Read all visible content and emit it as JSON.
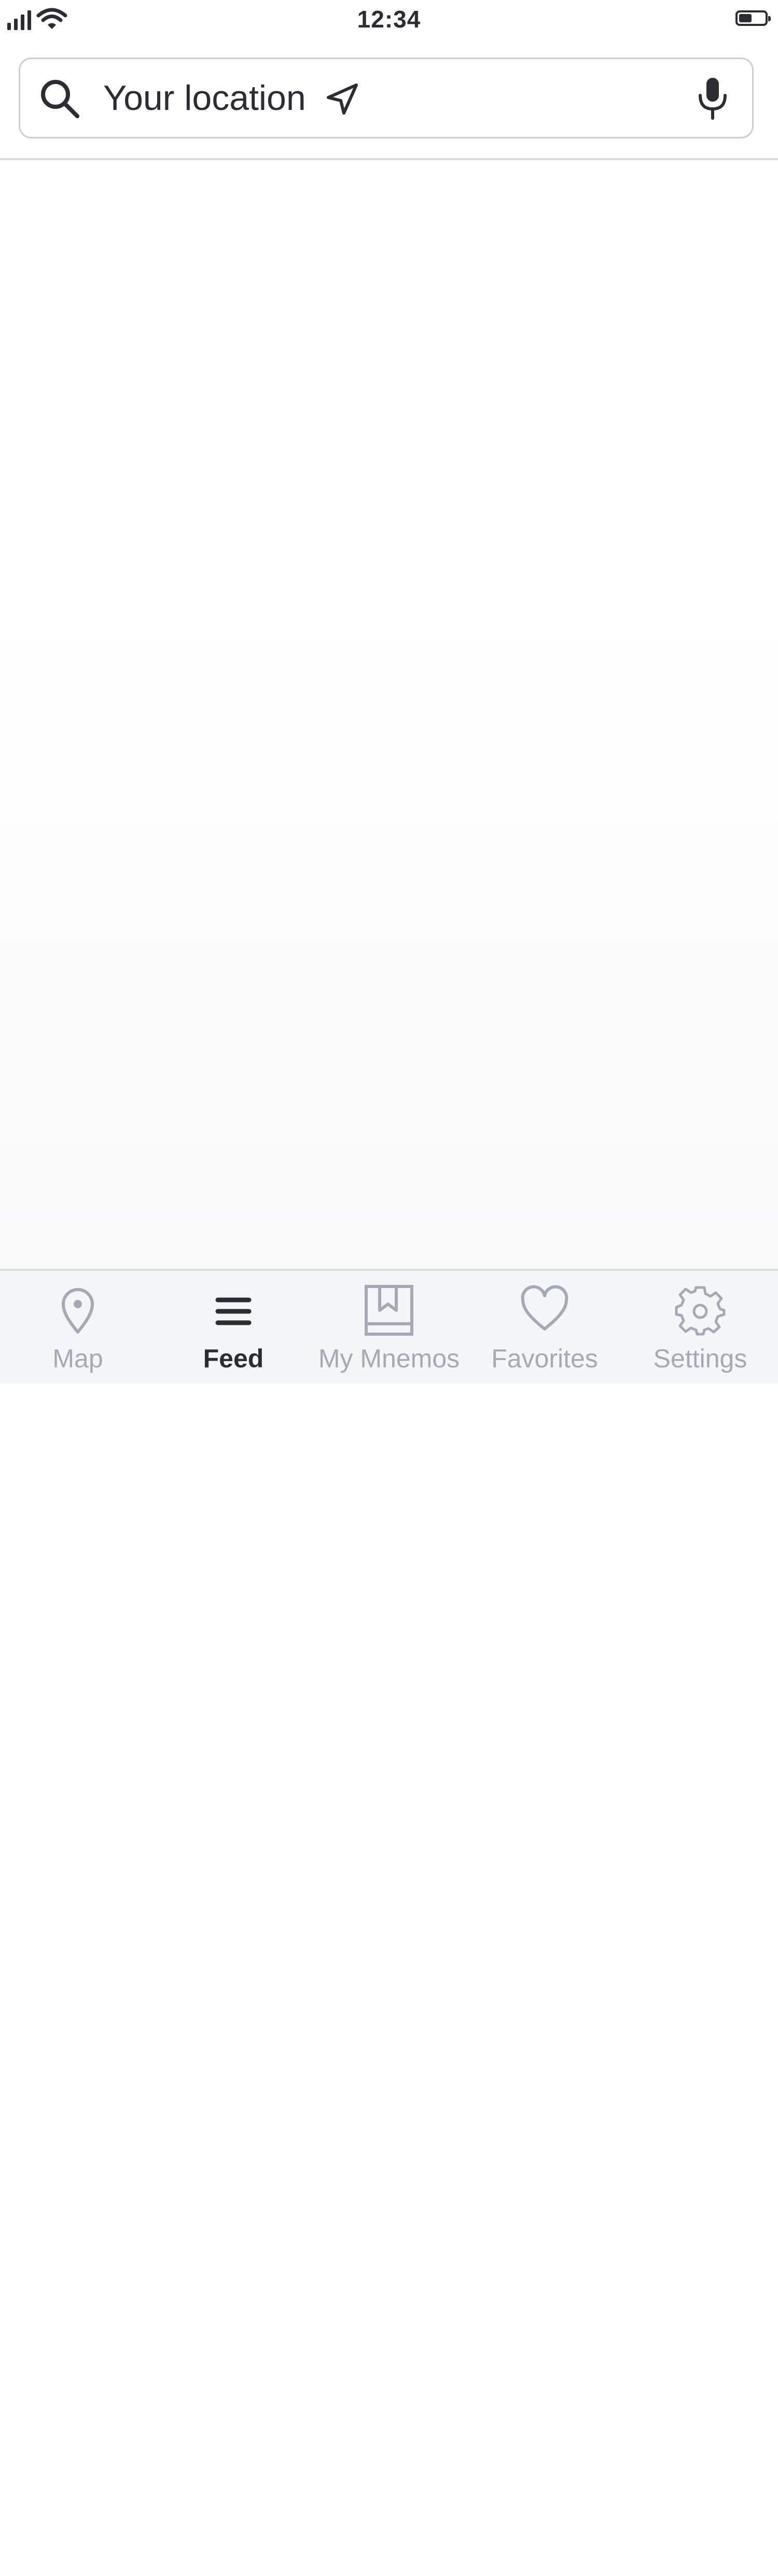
{
  "status_bar": {
    "time": "12:34"
  },
  "search": {
    "placeholder": "Your location",
    "icons": [
      "search-icon",
      "location-arrow-icon",
      "microphone-icon"
    ]
  },
  "tab_bar": {
    "active_tab": "Feed",
    "tabs": [
      {
        "label": "Map",
        "icon": "map-pin-icon"
      },
      {
        "label": "Feed",
        "icon": "menu-lines-icon"
      },
      {
        "label": "My Mnemos",
        "icon": "bookmark-book-icon"
      },
      {
        "label": "Favorites",
        "icon": "heart-icon"
      },
      {
        "label": "Settings",
        "icon": "gear-icon"
      }
    ]
  },
  "colors": {
    "text_dark": "#2b2d33",
    "tab_inactive": "#a3a9b5",
    "tab_bar_bg": "#f4f5f7",
    "border": "#c9cdd4"
  }
}
